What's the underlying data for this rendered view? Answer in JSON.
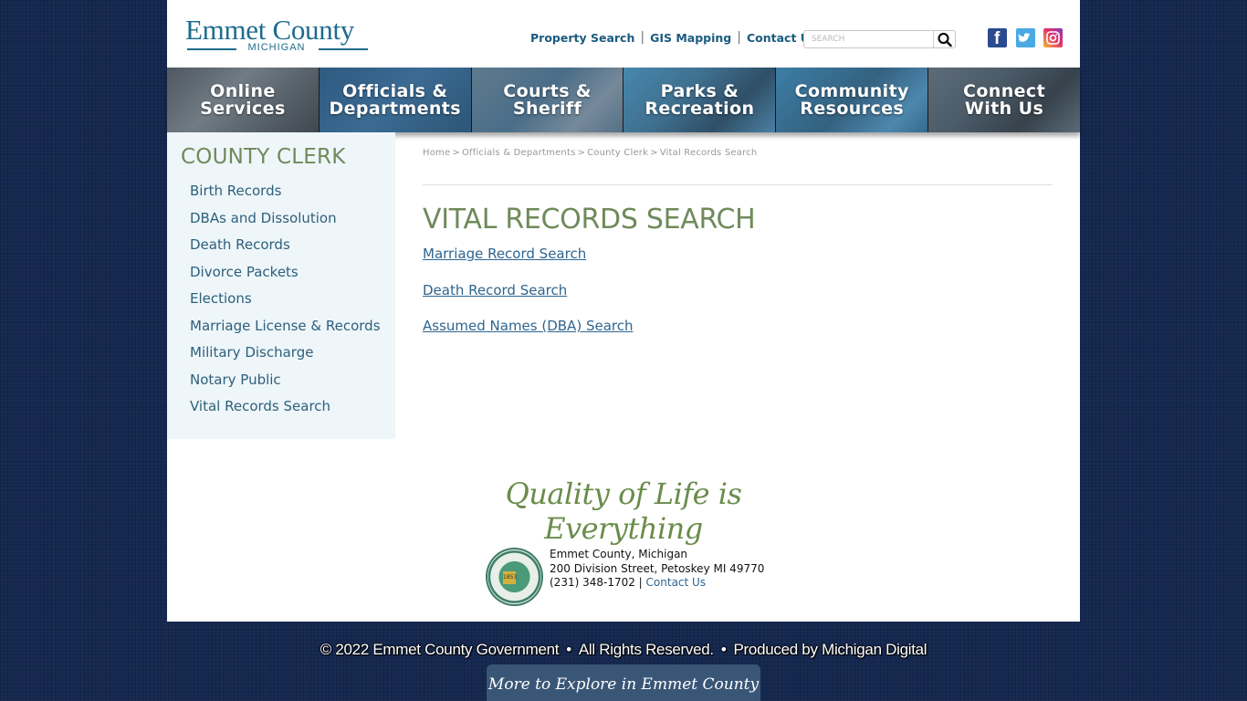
{
  "header": {
    "logo_main": "Emmet County",
    "logo_sub": "MICHIGAN",
    "top_links": [
      "Property Search",
      "GIS Mapping",
      "Contact Us"
    ],
    "search": {
      "placeholder": "SEARCH",
      "icon": "search-icon"
    },
    "social": [
      {
        "name": "facebook",
        "icon": "facebook-icon",
        "glyph": "f",
        "color": "#2b4b8f"
      },
      {
        "name": "twitter",
        "icon": "twitter-icon",
        "glyph": "t",
        "color": "#48a9e3"
      },
      {
        "name": "instagram",
        "icon": "instagram-icon",
        "glyph": "◎",
        "color": "#e1306c"
      }
    ]
  },
  "nav": [
    {
      "line1": "Online",
      "line2": "Services"
    },
    {
      "line1": "Officials &",
      "line2": "Departments"
    },
    {
      "line1": "Courts &",
      "line2": "Sheriff"
    },
    {
      "line1": "Parks &",
      "line2": "Recreation"
    },
    {
      "line1": "Community",
      "line2": "Resources"
    },
    {
      "line1": "Connect",
      "line2": "With Us"
    }
  ],
  "sidebar": {
    "title": "COUNTY CLERK",
    "items": [
      "Birth Records",
      "DBAs and Dissolution",
      "Death Records",
      "Divorce Packets",
      "Elections",
      "Marriage License & Records",
      "Military Discharge",
      "Notary Public",
      "Vital Records Search"
    ]
  },
  "breadcrumb": [
    "Home",
    "Officials & Departments",
    "County Clerk",
    "Vital Records Search"
  ],
  "breadcrumb_sep": ">",
  "main": {
    "title": "VITAL RECORDS SEARCH",
    "links": [
      "Marriage Record Search",
      "Death Record Search",
      "Assumed Names (DBA) Search"
    ]
  },
  "footer": {
    "tagline": "Quality of Life is Everything",
    "seal_year": "1853",
    "address_line1": "Emmet County, Michigan",
    "address_line2": "200 Division Street, Petoskey MI 49770",
    "phone": "(231) 348-1702 |",
    "contact_link": "Contact Us",
    "copyright_parts": [
      "© 2022 Emmet County Government",
      "All Rights Reserved.",
      "Produced by Michigan Digital"
    ],
    "dot": "•",
    "explore": "More to Explore in Emmet County"
  },
  "colors": {
    "brand_blue": "#1c6c8c",
    "link_blue": "#2e6590",
    "heading_green": "#6f8a5a",
    "background_navy": "#15284f",
    "sidebar_bg": "#eef6fa"
  }
}
